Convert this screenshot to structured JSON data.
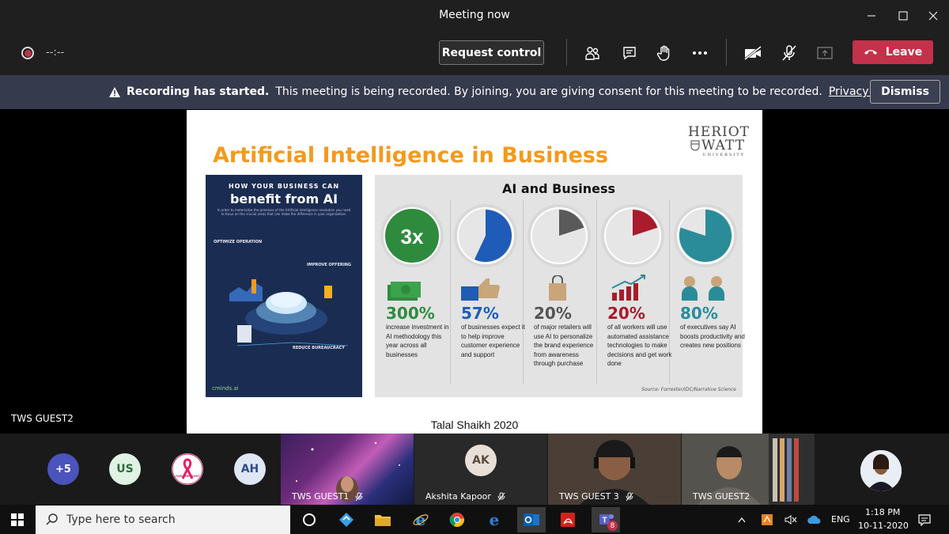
{
  "window": {
    "title": "Meeting now"
  },
  "toolbar": {
    "timer": "--:--",
    "request_control_label": "Request control",
    "leave_label": "Leave"
  },
  "banner": {
    "bold": "Recording has started.",
    "text": "This meeting is being recorded. By joining, you are giving consent for this meeting to be recorded.",
    "link": "Privacy policy",
    "dismiss_label": "Dismiss"
  },
  "slide": {
    "title": "Artificial Intelligence in Business",
    "logo_line1": "HERIOT",
    "logo_line2": "WATT",
    "logo_line3": "UNIVERSITY",
    "footer": "Talal Shaikh 2020",
    "left_infographic": {
      "header_small": "HOW YOUR BUSINESS CAN",
      "header_big": "benefit from AI",
      "intro": "In order to materialize the promises of the Artificial Intelligence revolution you need to focus on the crucial areas that can make the difference in your organization.",
      "section1": "OPTIMIZE OPERATION",
      "section2": "IMPROVE OFFERING",
      "section3": "REDUCE BUREAUCRACY",
      "brand": "cminds.ai"
    },
    "right_infographic": {
      "title": "AI and Business",
      "source": "Source: Forrester/IDC/Narrative Science",
      "columns": [
        {
          "badge": "3x",
          "stat": "300%",
          "desc": "increase investment in AI methodology this year across all businesses",
          "color": "#2e8b3e",
          "fraction": 1.0
        },
        {
          "badge": "",
          "stat": "57%",
          "desc": "of businesses expect it to help improve customer experience and support",
          "color": "#1e5cb8",
          "fraction": 0.57
        },
        {
          "badge": "",
          "stat": "20%",
          "desc": "of major retailers will use AI to personalize the brand experience from awareness through purchase",
          "color": "#5a5a5a",
          "fraction": 0.2
        },
        {
          "badge": "",
          "stat": "20%",
          "desc": "of all workers will use automated assistance technologies to make decisions and get work done",
          "color": "#a81c2b",
          "fraction": 0.2
        },
        {
          "badge": "",
          "stat": "80%",
          "desc": "of executives say AI boosts productivity and creates new positions",
          "color": "#2b8c99",
          "fraction": 0.8
        }
      ]
    }
  },
  "stage_label": "TWS GUEST2",
  "gallery": {
    "overflow": "+5",
    "avatars": [
      "US",
      "AH"
    ],
    "logo_text": "JOIN THE FIGHT",
    "tiles": [
      {
        "name": "TWS GUEST1"
      },
      {
        "name": "Akshita Kapoor",
        "initials": "AK"
      },
      {
        "name": "TWS GUEST 3"
      },
      {
        "name": "TWS GUEST2"
      }
    ]
  },
  "taskbar": {
    "search_placeholder": "Type here to search",
    "badge": "8",
    "lang": "ENG",
    "time": "1:18 PM",
    "date": "10-11-2020"
  }
}
